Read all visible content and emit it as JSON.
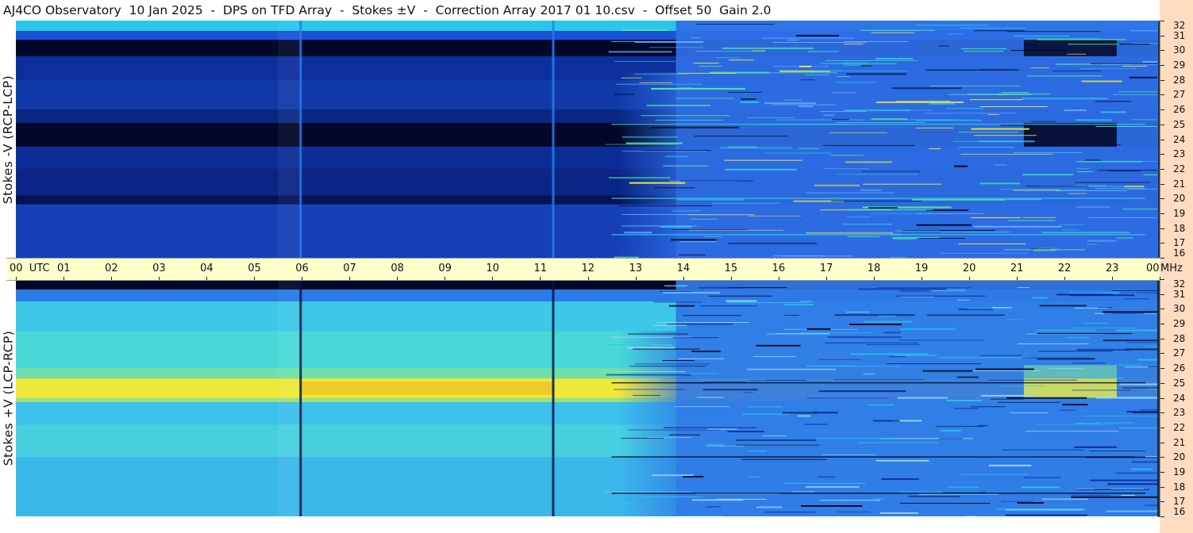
{
  "title": "AJ4CO Observatory  10 Jan 2025  -  DPS on TFD Array  -  Stokes ±V  -  Correction Array 2017 01 10.csv  -  Offset 50  Gain 2.0",
  "chart_data": {
    "type": "heatmap",
    "panels": [
      {
        "ylabel": "Stokes -V (RCP-LCP)",
        "colormap": "dark-blue-to-yellow"
      },
      {
        "ylabel": "Stokes +V (LCP-RCP)",
        "colormap": "blue-to-yellow"
      }
    ],
    "x_axis": {
      "tick_labels": [
        "00",
        "01",
        "02",
        "03",
        "04",
        "05",
        "06",
        "07",
        "08",
        "09",
        "10",
        "11",
        "12",
        "13",
        "14",
        "15",
        "16",
        "17",
        "18",
        "19",
        "20",
        "21",
        "22",
        "23",
        "00"
      ],
      "unit_label": "UTC",
      "range_hours": [
        0,
        24
      ]
    },
    "y_axis": {
      "tick_labels": [
        "32",
        "31",
        "30",
        "29",
        "28",
        "27",
        "26",
        "25",
        "24",
        "23",
        "22",
        "21",
        "20",
        "19",
        "18",
        "17",
        "16"
      ],
      "range_mhz": [
        16,
        32
      ],
      "unit_label": "MHz"
    },
    "colors": {
      "dark": "#030828",
      "deep_blue": "#0a2a9a",
      "blue": "#1a52d8",
      "mid_blue": "#2a7ae8",
      "cyan": "#28c8e8",
      "green": "#50e8a0",
      "yellow": "#f0e838",
      "orange": "#f0b020",
      "time_axis_bg": "#ffffcc",
      "freq_axis_bg": "#ffdcc0"
    }
  }
}
